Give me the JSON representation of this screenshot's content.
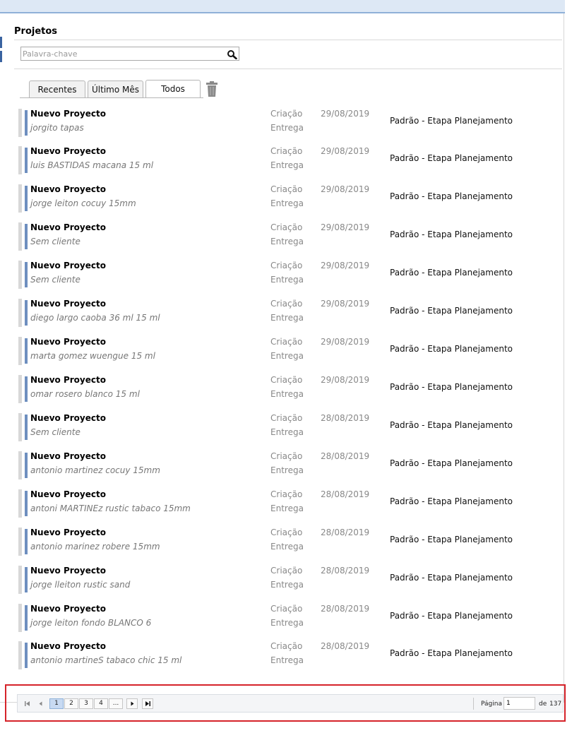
{
  "page": {
    "title": "Projetos"
  },
  "search": {
    "placeholder": "Palavra-chave",
    "value": ""
  },
  "tabs": [
    {
      "label": "Recentes"
    },
    {
      "label": "Último Mês"
    },
    {
      "label": "Todos"
    }
  ],
  "active_tab": "Todos",
  "row_labels": {
    "created": "Criação",
    "delivery": "Entrega"
  },
  "projects": [
    {
      "name": "Nuevo Proyecto",
      "client": "jorgito tapas",
      "date": "29/08/2019",
      "stage": "Padrão - Etapa Planejamento"
    },
    {
      "name": "Nuevo Proyecto",
      "client": "luis BASTIDAS macana 15 ml",
      "date": "29/08/2019",
      "stage": "Padrão - Etapa Planejamento"
    },
    {
      "name": "Nuevo Proyecto",
      "client": "jorge leiton cocuy 15mm",
      "date": "29/08/2019",
      "stage": "Padrão - Etapa Planejamento"
    },
    {
      "name": "Nuevo Proyecto",
      "client": "Sem cliente",
      "date": "29/08/2019",
      "stage": "Padrão - Etapa Planejamento"
    },
    {
      "name": "Nuevo Proyecto",
      "client": "Sem cliente",
      "date": "29/08/2019",
      "stage": "Padrão - Etapa Planejamento"
    },
    {
      "name": "Nuevo Proyecto",
      "client": "diego largo caoba 36 ml 15 ml",
      "date": "29/08/2019",
      "stage": "Padrão - Etapa Planejamento"
    },
    {
      "name": "Nuevo Proyecto",
      "client": "marta gomez  wuengue 15 ml",
      "date": "29/08/2019",
      "stage": "Padrão - Etapa Planejamento"
    },
    {
      "name": "Nuevo Proyecto",
      "client": "omar rosero blanco 15 ml",
      "date": "29/08/2019",
      "stage": "Padrão - Etapa Planejamento"
    },
    {
      "name": "Nuevo Proyecto",
      "client": "Sem cliente",
      "date": "28/08/2019",
      "stage": "Padrão - Etapa Planejamento"
    },
    {
      "name": "Nuevo Proyecto",
      "client": "antonio martinez cocuy 15mm",
      "date": "28/08/2019",
      "stage": "Padrão - Etapa Planejamento"
    },
    {
      "name": "Nuevo Proyecto",
      "client": "antoni MARTINEz rustic tabaco 15mm",
      "date": "28/08/2019",
      "stage": "Padrão - Etapa Planejamento"
    },
    {
      "name": "Nuevo Proyecto",
      "client": "antonio marinez robere 15mm",
      "date": "28/08/2019",
      "stage": "Padrão - Etapa Planejamento"
    },
    {
      "name": "Nuevo Proyecto",
      "client": "jorge lleiton  rustic sand",
      "date": "28/08/2019",
      "stage": "Padrão - Etapa Planejamento"
    },
    {
      "name": "Nuevo Proyecto",
      "client": "jorge leiton fondo BLANCO 6",
      "date": "28/08/2019",
      "stage": "Padrão - Etapa Planejamento"
    },
    {
      "name": "Nuevo Proyecto",
      "client": "antonio martineS tabaco chic 15 ml",
      "date": "28/08/2019",
      "stage": "Padrão - Etapa Planejamento"
    }
  ],
  "pager": {
    "pages": [
      "1",
      "2",
      "3",
      "4"
    ],
    "ellipsis": "...",
    "current_page": "1",
    "page_label": "Página",
    "page_input": "1",
    "of_label": "de",
    "total_pages": "137"
  },
  "colors": {
    "accent": "#6e8fbf",
    "highlight_border": "#d6232a"
  }
}
